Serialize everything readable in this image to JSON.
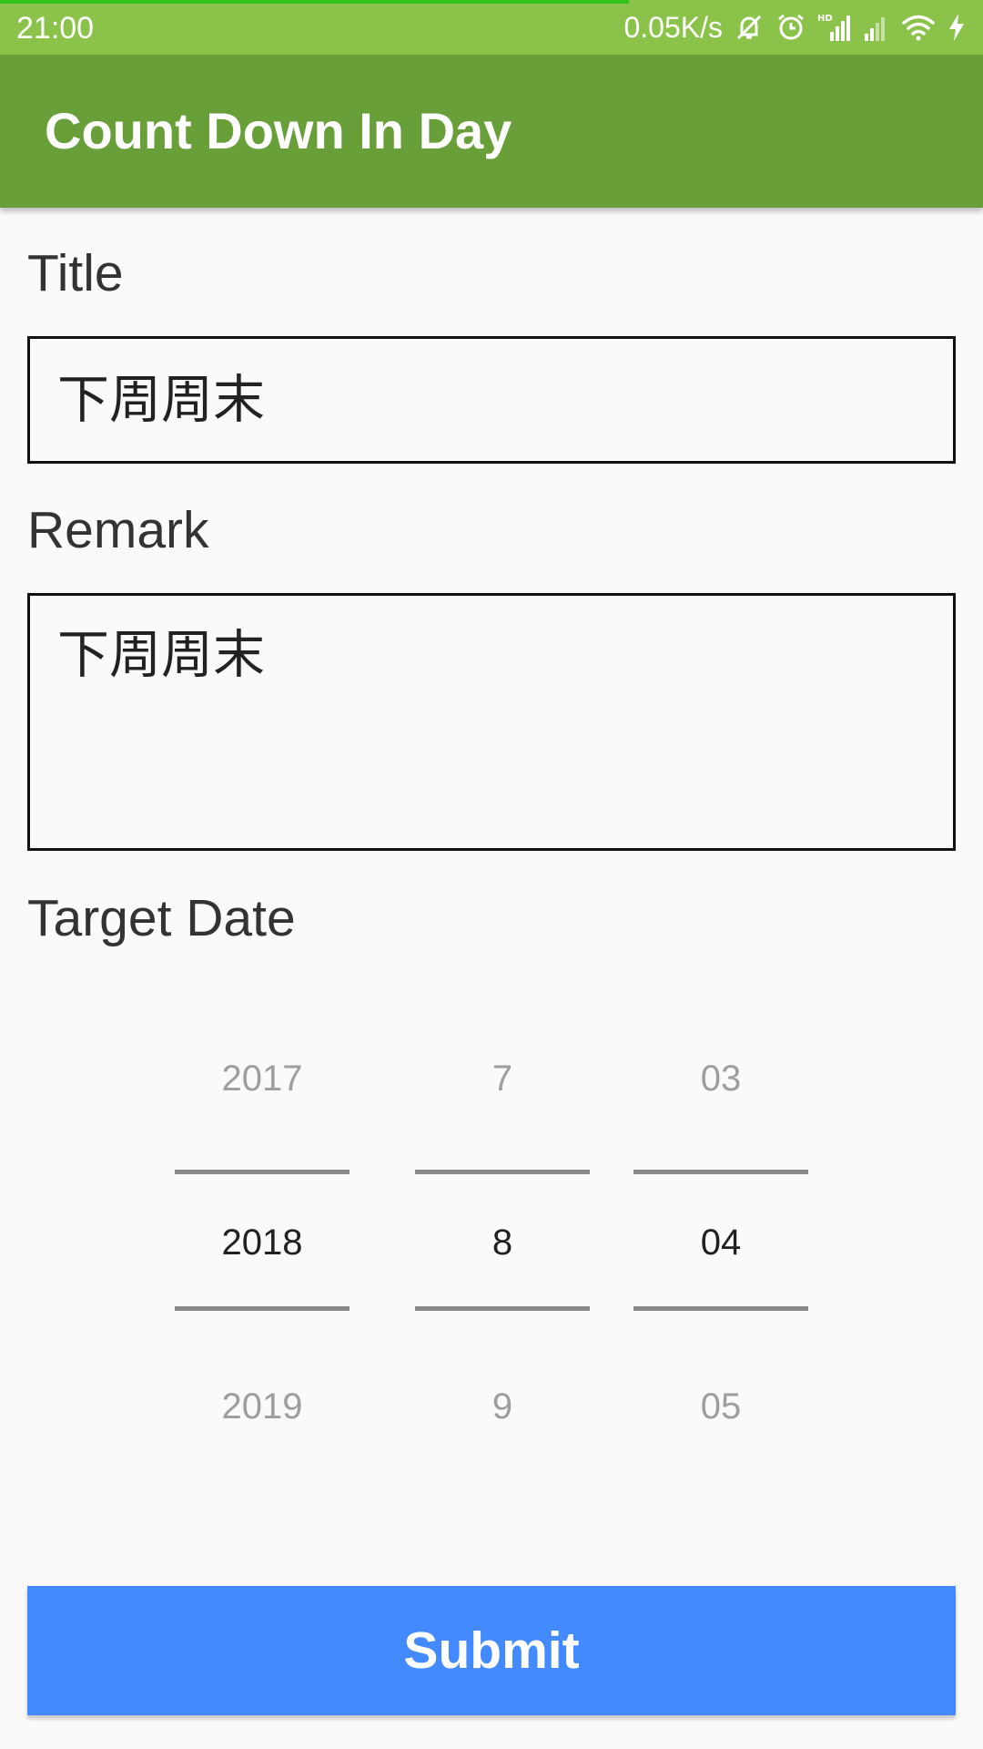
{
  "status_bar": {
    "time": "21:00",
    "network_speed": "0.05K/s",
    "hd_badge": "HD",
    "icons": [
      "muted-bell-icon",
      "alarm-clock-icon",
      "hd-signal-icon",
      "signal-icon",
      "wifi-icon",
      "charging-icon"
    ],
    "page_load_progress": 0.64
  },
  "app_bar": {
    "title": "Count Down In Day"
  },
  "form": {
    "title_label": "Title",
    "title_value": "下周周末",
    "remark_label": "Remark",
    "remark_value": "下周周末",
    "target_date_label": "Target Date"
  },
  "date_picker": {
    "year": {
      "prev": "2017",
      "selected": "2018",
      "next": "2019"
    },
    "month": {
      "prev": "7",
      "selected": "8",
      "next": "9"
    },
    "day": {
      "prev": "03",
      "selected": "04",
      "next": "05"
    }
  },
  "submit_label": "Submit",
  "colors": {
    "status_bar": "#8bc34a",
    "app_bar": "#689f38",
    "submit_button": "#448aff",
    "progress": "#33c21a"
  }
}
